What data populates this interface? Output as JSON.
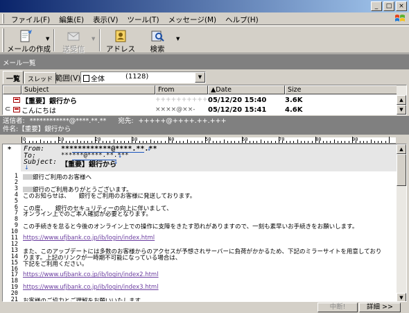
{
  "window": {
    "minimize": "_",
    "maximize": "□",
    "close": "×"
  },
  "menu": [
    "ファイル(F)",
    "編集(E)",
    "表示(V)",
    "ツール(T)",
    "メッセージ(M)",
    "ヘルプ(H)"
  ],
  "toolbar": {
    "compose": "メールの作成",
    "send_receive": "送受信",
    "address": "アドレス",
    "search": "検索"
  },
  "folder_title": "メール一覧",
  "tabs": {
    "list": "一覧",
    "thread": "スレッド"
  },
  "range": {
    "label": "範囲(V):",
    "value": "全体",
    "count": "(1128)"
  },
  "columns": {
    "subject": "Subject",
    "from": "From",
    "date": "▲Date",
    "size": "Size"
  },
  "messages": [
    {
      "subject": "【重要】銀行から",
      "from": "++++++++++++@++++",
      "date": "05/12/20 15:40",
      "size": "3.6K",
      "bold": true,
      "attachment": false
    },
    {
      "subject": "こんにちは",
      "from": "××××@××-",
      "date": "05/12/20 15:41",
      "size": "4.6K",
      "bold": true,
      "attachment": true
    }
  ],
  "header_info": {
    "sender_label": "送信者:",
    "sender": "************@****.**.**",
    "to_label": "宛先:",
    "to": "+++++@++++.++.+++",
    "subject_label": "件名:",
    "subject": "【重要】銀行から"
  },
  "ruler": [
    "0",
    "10",
    "20",
    "30",
    "40",
    "50",
    "60",
    "70",
    "80",
    "90"
  ],
  "body_header": {
    "marker": "*",
    "from_label": "From:",
    "from": "************@****.**.**",
    "to_label": "To:",
    "to": "******@****.**.***",
    "subject_label": "Subject:",
    "subject": "【重要】銀行から",
    "arrow": "↓"
  },
  "body_lines": [
    {
      "n": "1",
      "text": "銀行ご利用のお客様へ",
      "blur": true
    },
    {
      "n": "2",
      "text": ""
    },
    {
      "n": "3",
      "text": "銀行のご利用ありがとうございます。",
      "blur": true
    },
    {
      "n": "4",
      "text": "このお知らせは、　　銀行をご利用のお客様に発送しております。"
    },
    {
      "n": "5",
      "text": ""
    },
    {
      "n": "6",
      "text": "この度、　　銀行のセキュリティーの向上に伴いまして、"
    },
    {
      "n": "7",
      "text": "オンライン上でのご本人確認が必要となります。"
    },
    {
      "n": "8",
      "text": ""
    },
    {
      "n": "9",
      "text": "この手続きを怠ると今後のオンライン上での操作に支障をきたす恐れがありますので、一刻も素早いお手続きをお願いします。"
    },
    {
      "n": "10",
      "text": ""
    },
    {
      "n": "11",
      "text": "https://www.ufjbank.co.jp/ib/login/index.html",
      "link": true
    },
    {
      "n": "12",
      "text": ""
    },
    {
      "n": "13",
      "text": "また、このアップデートには多数のお客様からのアクセスが予想されサーバーに負荷がかかるため、下記のミラーサイトを用意しており"
    },
    {
      "n": "14",
      "text": "ります。上記のリンクが一時期不可能になっている場合は、"
    },
    {
      "n": "15",
      "text": "下記をご利用ください。"
    },
    {
      "n": "16",
      "text": ""
    },
    {
      "n": "17",
      "text": "https://www.ufjbank.co.jp/ib/login/index2.html",
      "link": true
    },
    {
      "n": "18",
      "text": ""
    },
    {
      "n": "19",
      "text": "https://www.ufjbank.co.jp/ib/login/index3.html",
      "link": true
    },
    {
      "n": "20",
      "text": ""
    },
    {
      "n": "21",
      "text": "お客様のご協力とご理解をお願いいたします。"
    }
  ],
  "status": {
    "abort": "中断!",
    "detail": "詳細 >>"
  }
}
